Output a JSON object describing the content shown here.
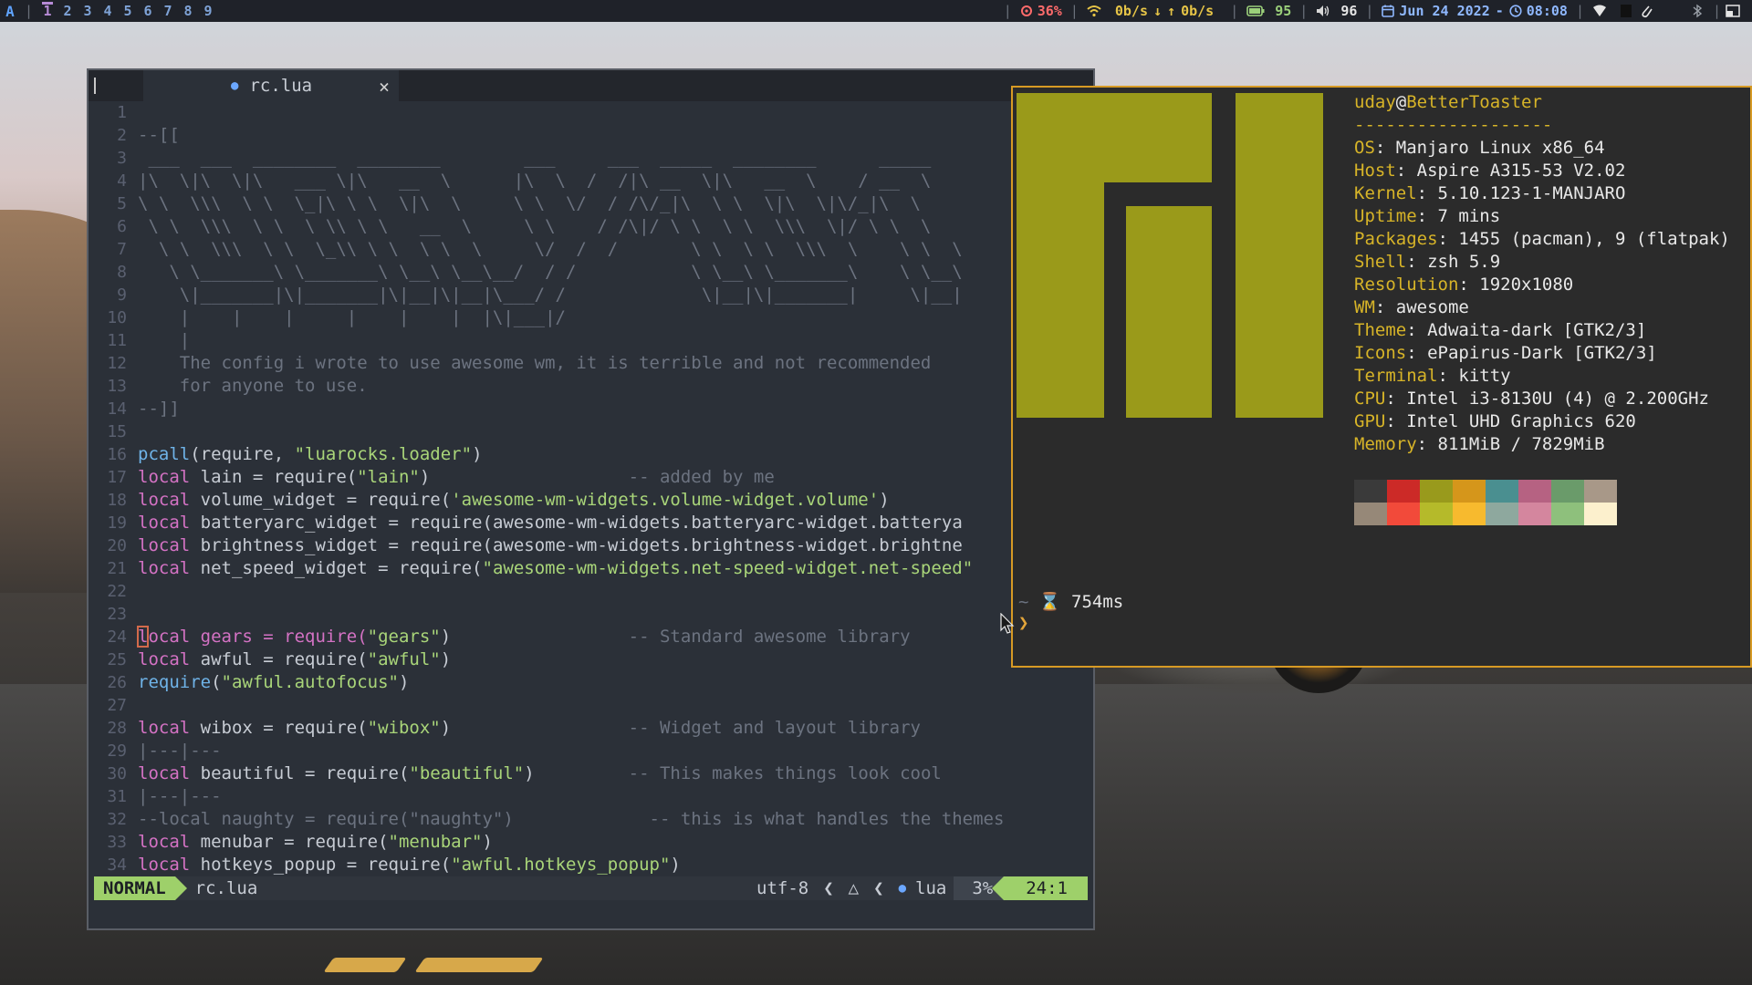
{
  "topbar": {
    "launcher": "A",
    "tags": [
      "1",
      "2",
      "3",
      "4",
      "5",
      "6",
      "7",
      "8",
      "9"
    ],
    "active_tag_index": 0,
    "cpu": "36%",
    "net_down": "0b/s",
    "net_up": "0b/s",
    "battery": "95",
    "volume": "96",
    "date": "Jun 24 2022",
    "date_sep": "-",
    "time": "08:08"
  },
  "editor": {
    "tab": {
      "filename": "rc.lua",
      "close": "×"
    },
    "lines": [
      {
        "n": "1",
        "t": ""
      },
      {
        "n": "2",
        "t": "--[["
      },
      {
        "n": "3",
        "t": " ___  ___  ________  ________        ___     ___  _____  ________      _____ "
      },
      {
        "n": "4",
        "t": "|\\  \\|\\  \\|\\   ___ \\|\\   __  \\      |\\  \\  /  /|\\ __  \\|\\   __  \\    / __  \\ "
      },
      {
        "n": "5",
        "t": "\\ \\  \\\\\\  \\ \\  \\_|\\ \\ \\  \\|\\  \\     \\ \\  \\/  / /\\/_|\\  \\ \\  \\|\\  \\|\\/_|\\  \\"
      },
      {
        "n": "6",
        "t": " \\ \\  \\\\\\  \\ \\  \\ \\\\ \\ \\   __  \\     \\ \\    / /\\|/ \\ \\  \\ \\  \\\\\\  \\|/ \\ \\  \\"
      },
      {
        "n": "7",
        "t": "  \\ \\  \\\\\\  \\ \\  \\_\\\\ \\ \\  \\ \\  \\     \\/  /  /       \\ \\  \\ \\  \\\\\\  \\    \\ \\  \\"
      },
      {
        "n": "8",
        "t": "   \\ \\_______\\ \\_______\\ \\__\\ \\__\\__/  / /           \\ \\__\\ \\_______\\    \\ \\__\\"
      },
      {
        "n": "9",
        "t": "    \\|_______|\\|_______|\\|__|\\|__|\\___/ /             \\|__|\\|_______|     \\|__|"
      },
      {
        "n": "10",
        "t": "    |    |    |     |    |    |  |\\|___|/"
      },
      {
        "n": "11",
        "t": "    |"
      },
      {
        "n": "12",
        "t": "    The config i wrote to use awesome wm, it is terrible and not recommended"
      },
      {
        "n": "13",
        "t": "    for anyone to use."
      },
      {
        "n": "14",
        "t": "--]]"
      },
      {
        "n": "15",
        "t": ""
      },
      {
        "n": "16",
        "t": "pcall(require, \"luarocks.loader\")"
      },
      {
        "n": "17",
        "t": "local lain = require(\"lain\")                   -- added by me"
      },
      {
        "n": "18",
        "t": "local volume_widget = require('awesome-wm-widgets.volume-widget.volume')"
      },
      {
        "n": "19",
        "t": "local batteryarc_widget = require(\"awesome-wm-widgets.batteryarc-widget.batterya"
      },
      {
        "n": "20",
        "t": "local brightness_widget = require(\"awesome-wm-widgets.brightness-widget.brightne"
      },
      {
        "n": "21",
        "t": "local net_speed_widget = require(\"awesome-wm-widgets.net-speed-widget.net-speed\""
      },
      {
        "n": "22",
        "t": ""
      },
      {
        "n": "23",
        "t": ""
      },
      {
        "n": "24",
        "t": "local gears = require(\"gears\")                 -- Standard awesome library"
      },
      {
        "n": "25",
        "t": "local awful = require(\"awful\")"
      },
      {
        "n": "26",
        "t": "require(\"awful.autofocus\")"
      },
      {
        "n": "27",
        "t": ""
      },
      {
        "n": "28",
        "t": "local wibox = require(\"wibox\")                 -- Widget and layout library"
      },
      {
        "n": "29",
        "t": "|---|---"
      },
      {
        "n": "30",
        "t": "local beautiful = require(\"beautiful\")         -- This makes things look cool"
      },
      {
        "n": "31",
        "t": "|---|---"
      },
      {
        "n": "32",
        "t": "--local naughty = require(\"naughty\")             -- this is what handles the themes"
      },
      {
        "n": "33",
        "t": "local menubar = require(\"menubar\")"
      },
      {
        "n": "34",
        "t": "local hotkeys_popup = require(\"awful.hotkeys_popup\")"
      }
    ],
    "status": {
      "mode": "NORMAL",
      "file": "rc.lua",
      "encoding": "utf-8",
      "filetype": "lua",
      "percent": "3%",
      "position": "24:1"
    }
  },
  "terminal": {
    "user": "uday",
    "at": "@",
    "host": "BetterToaster",
    "rule": "-------------------",
    "info": [
      {
        "k": "OS",
        "v": "Manjaro Linux x86_64"
      },
      {
        "k": "Host",
        "v": "Aspire A315-53 V2.02"
      },
      {
        "k": "Kernel",
        "v": "5.10.123-1-MANJARO"
      },
      {
        "k": "Uptime",
        "v": "7 mins"
      },
      {
        "k": "Packages",
        "v": "1455 (pacman), 9 (flatpak)"
      },
      {
        "k": "Shell",
        "v": "zsh 5.9"
      },
      {
        "k": "Resolution",
        "v": "1920x1080"
      },
      {
        "k": "WM",
        "v": "awesome"
      },
      {
        "k": "Theme",
        "v": "Adwaita-dark [GTK2/3]"
      },
      {
        "k": "Icons",
        "v": "ePapirus-Dark [GTK2/3]"
      },
      {
        "k": "Terminal",
        "v": "kitty"
      },
      {
        "k": "CPU",
        "v": "Intel i3-8130U (4) @ 2.200GHz"
      },
      {
        "k": "GPU",
        "v": "Intel UHD Graphics 620"
      },
      {
        "k": "Memory",
        "v": "811MiB / 7829MiB"
      }
    ],
    "palette_row1": [
      "#3a3a3a",
      "#cc2a27",
      "#999a1c",
      "#d5961b",
      "#4a8f90",
      "#b66282",
      "#6a9b6a",
      "#a89888"
    ],
    "palette_row2": [
      "#968878",
      "#f24a3a",
      "#b5ba2a",
      "#f7ba2e",
      "#8ea89e",
      "#d4869e",
      "#8ec07c",
      "#fcf0cd"
    ],
    "logo_color": "#9a9a1a",
    "prompt_tilde": "~",
    "prompt_time": "754ms",
    "prompt_symbol": "❯"
  }
}
